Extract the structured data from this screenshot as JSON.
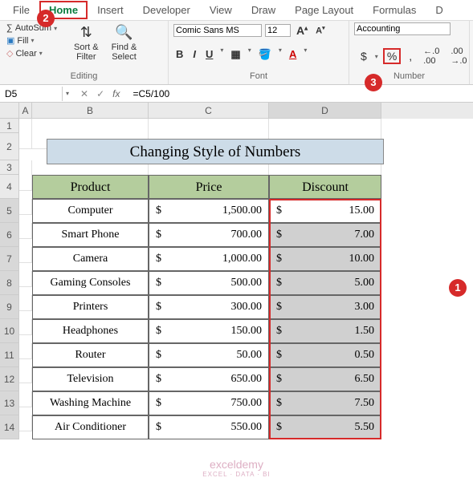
{
  "menu": {
    "tabs": [
      "File",
      "Home",
      "Insert",
      "Developer",
      "View",
      "Draw",
      "Page Layout",
      "Formulas",
      "D"
    ]
  },
  "ribbon": {
    "editing": {
      "autosum": "AutoSum",
      "fill": "Fill",
      "clear": "Clear",
      "sortfilter": "Sort &\nFilter",
      "findselect": "Find &\nSelect",
      "label": "Editing"
    },
    "font": {
      "name": "Comic Sans MS",
      "size": "12",
      "bold": "B",
      "italic": "I",
      "underline": "U",
      "label": "Font"
    },
    "number": {
      "format": "Accounting",
      "label": "Number"
    }
  },
  "formula": {
    "cell": "D5",
    "value": "=C5/100"
  },
  "columns": [
    "A",
    "B",
    "C",
    "D"
  ],
  "rows": [
    "1",
    "2",
    "3",
    "4",
    "5",
    "6",
    "7",
    "8",
    "9",
    "10",
    "11",
    "12",
    "13",
    "14"
  ],
  "title_text": "Changing Style of Numbers",
  "headers": {
    "product": "Product",
    "price": "Price",
    "discount": "Discount"
  },
  "data": [
    {
      "product": "Computer",
      "price": "1,500.00",
      "discount": "15.00"
    },
    {
      "product": "Smart Phone",
      "price": "700.00",
      "discount": "7.00"
    },
    {
      "product": "Camera",
      "price": "1,000.00",
      "discount": "10.00"
    },
    {
      "product": "Gaming Consoles",
      "price": "500.00",
      "discount": "5.00"
    },
    {
      "product": "Printers",
      "price": "300.00",
      "discount": "3.00"
    },
    {
      "product": "Headphones",
      "price": "150.00",
      "discount": "1.50"
    },
    {
      "product": "Router",
      "price": "50.00",
      "discount": "0.50"
    },
    {
      "product": "Television",
      "price": "650.00",
      "discount": "6.50"
    },
    {
      "product": "Washing Machine",
      "price": "750.00",
      "discount": "7.50"
    },
    {
      "product": "Air Conditioner",
      "price": "550.00",
      "discount": "5.50"
    }
  ],
  "currency": "$",
  "callouts": {
    "one": "1",
    "two": "2",
    "three": "3"
  },
  "watermark": {
    "main": "exceldemy",
    "sub": "EXCEL · DATA · BI"
  }
}
